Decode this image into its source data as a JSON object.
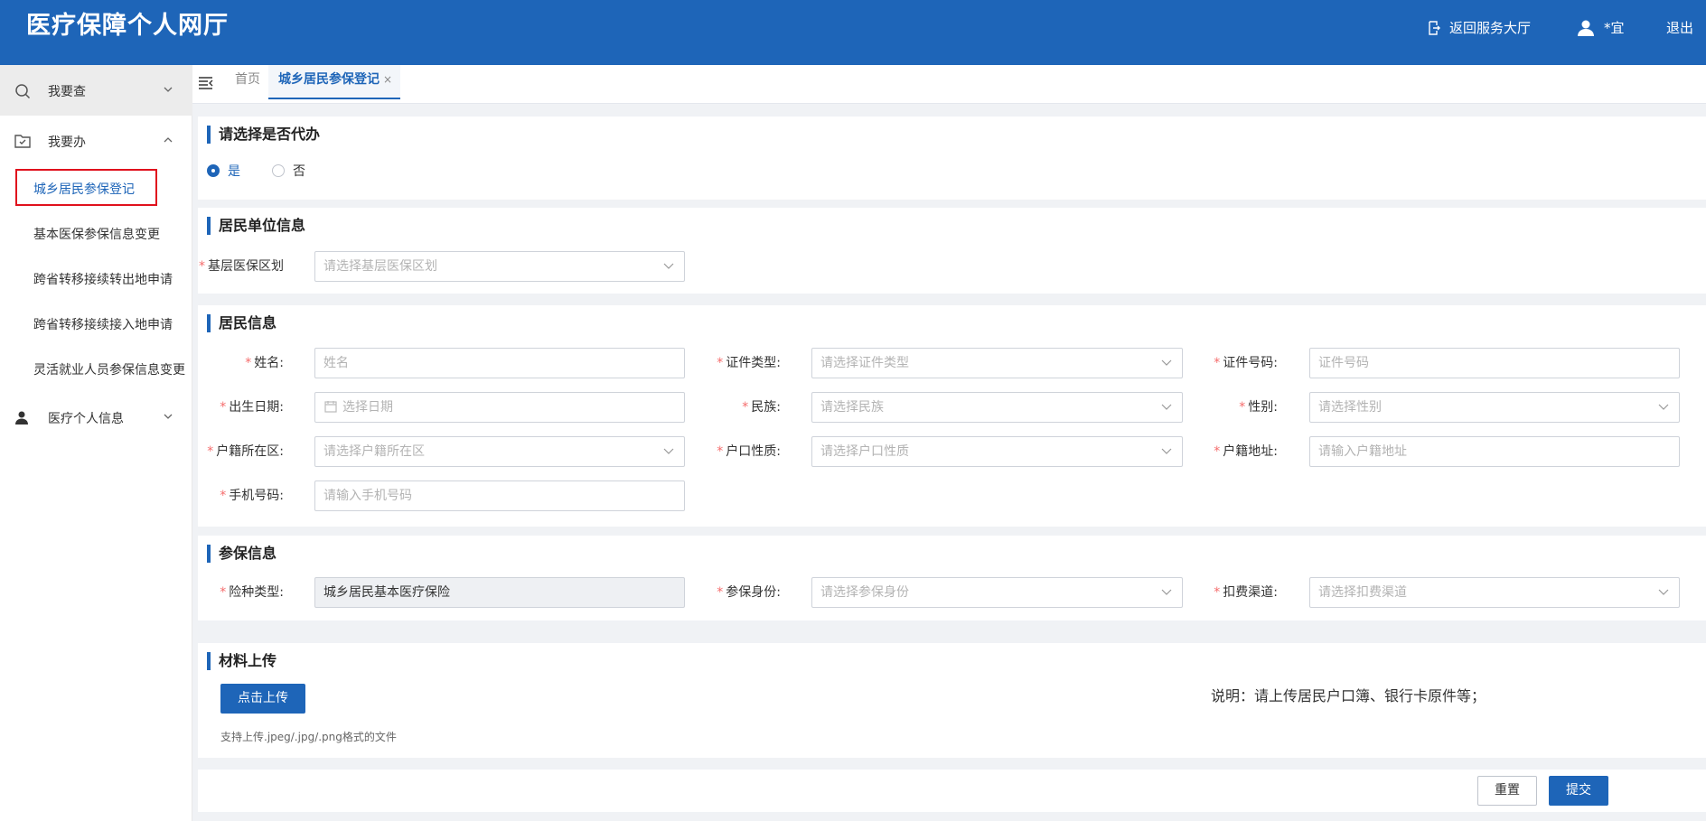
{
  "header": {
    "title": "医疗保障个人网厅",
    "return_hall": "返回服务大厅",
    "user_name": "*宜",
    "logout": "退出"
  },
  "sidebar": {
    "query": "我要查",
    "handle": "我要办",
    "sub_items": [
      "城乡居民参保登记",
      "基本医保参保信息变更",
      "跨省转移接续转出地申请",
      "跨省转移接续接入地申请",
      "灵活就业人员参保信息变更"
    ],
    "personal_info": "医疗个人信息"
  },
  "tabs": {
    "home": "首页",
    "active": "城乡居民参保登记",
    "close": "×"
  },
  "agent": {
    "title": "请选择是否代办",
    "yes": "是",
    "no": "否",
    "selected": "是"
  },
  "unit": {
    "title": "居民单位信息",
    "district_label": "基层医保区划",
    "district_placeholder": "请选择基层医保区划"
  },
  "resident": {
    "title": "居民信息",
    "name_label": "姓名:",
    "name_placeholder": "姓名",
    "id_type_label": "证件类型:",
    "id_type_placeholder": "请选择证件类型",
    "id_no_label": "证件号码:",
    "id_no_placeholder": "证件号码",
    "birth_label": "出生日期:",
    "birth_placeholder": "选择日期",
    "ethnic_label": "民族:",
    "ethnic_placeholder": "请选择民族",
    "gender_label": "性别:",
    "gender_placeholder": "请选择性别",
    "hukou_area_label": "户籍所在区:",
    "hukou_area_placeholder": "请选择户籍所在区",
    "hukou_type_label": "户口性质:",
    "hukou_type_placeholder": "请选择户口性质",
    "hukou_addr_label": "户籍地址:",
    "hukou_addr_placeholder": "请输入户籍地址",
    "phone_label": "手机号码:",
    "phone_placeholder": "请输入手机号码"
  },
  "insurance": {
    "title": "参保信息",
    "type_label": "险种类型:",
    "type_value": "城乡居民基本医疗保险",
    "identity_label": "参保身份:",
    "identity_placeholder": "请选择参保身份",
    "channel_label": "扣费渠道:",
    "channel_placeholder": "请选择扣费渠道"
  },
  "upload": {
    "title": "材料上传",
    "button": "点击上传",
    "hint": "支持上传.jpeg/.jpg/.png格式的文件",
    "note": "说明：请上传居民户口簿、银行卡原件等；"
  },
  "actions": {
    "reset": "重置",
    "submit": "提交"
  },
  "colors": {
    "primary": "#1e65b8",
    "required": "#f56c6c",
    "highlight": "#e0111d"
  }
}
